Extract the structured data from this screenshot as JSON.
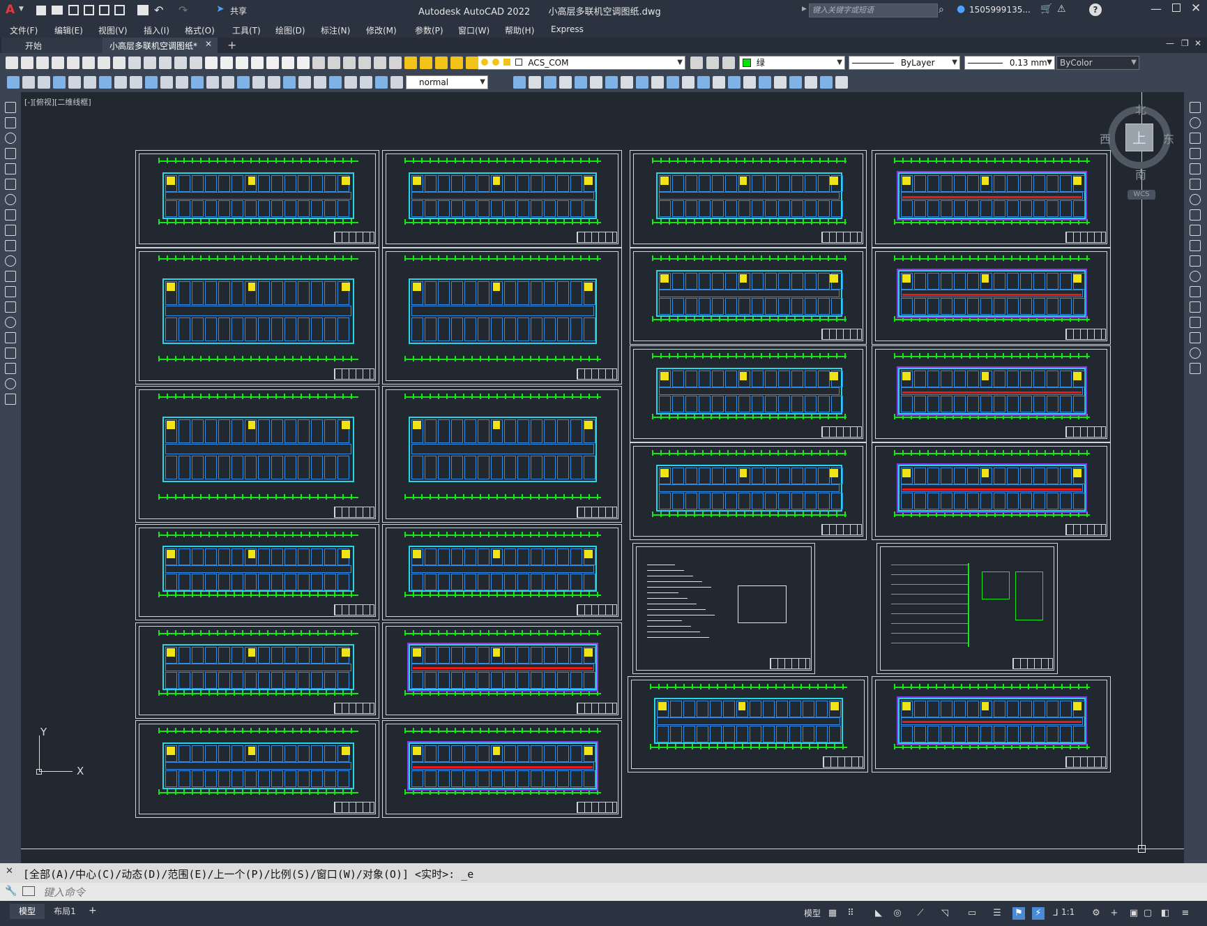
{
  "app": {
    "title": "Autodesk AutoCAD 2022",
    "document": "小高层多联机空调图纸.dwg",
    "share_label": "共享",
    "search_placeholder": "键入关键字或短语",
    "user": "1505999135...",
    "window_controls": [
      "minimize-icon",
      "restore-icon",
      "close-icon"
    ]
  },
  "menu": {
    "items": [
      "文件(F)",
      "编辑(E)",
      "视图(V)",
      "插入(I)",
      "格式(O)",
      "工具(T)",
      "绘图(D)",
      "标注(N)",
      "修改(M)",
      "参数(P)",
      "窗口(W)",
      "帮助(H)",
      "Express"
    ]
  },
  "tabs": {
    "start": "开始",
    "active": "小高层多联机空调图纸*",
    "add": "+"
  },
  "properties": {
    "layer": "ACS_COM",
    "color": "绿",
    "linetype": "ByLayer",
    "lineweight": "0.13 mm",
    "plotstyle": "ByColor",
    "textstyle": "normal",
    "color_swatch": "#00e600"
  },
  "viewport": {
    "label": "[-][俯视][二维线框]",
    "viewcube": {
      "north": "北",
      "south": "南",
      "east": "东",
      "west": "西",
      "top": "上",
      "wcs": "WCS"
    },
    "ucs": {
      "x": "X",
      "y": "Y"
    }
  },
  "command": {
    "history": "[全部(A)/中心(C)/动态(D)/范围(E)/上一个(P)/比例(S)/窗口(W)/对象(O)] <实时>: _e",
    "placeholder": "键入命令"
  },
  "status": {
    "layout_tabs": [
      "模型",
      "布局1"
    ],
    "model_label": "模型",
    "scale": "1:1"
  },
  "colors": {
    "canvas": "#212830",
    "grid_green": "#17e617",
    "wall_cyan": "#27d6e6",
    "duct_red": "#e81a1a",
    "unit_yellow": "#f0e416"
  }
}
